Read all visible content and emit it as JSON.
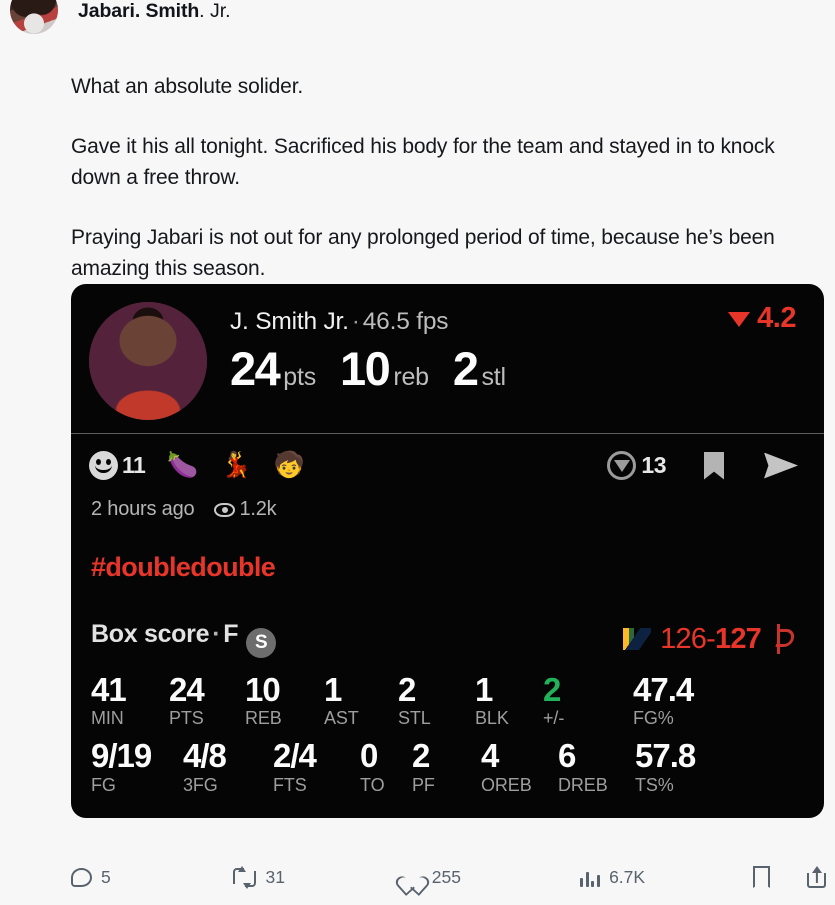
{
  "post": {
    "author": {
      "name_bold": "Jabari. Smith",
      "name_rest": ". Jr."
    },
    "paragraphs": [
      "What an absolute solider.",
      "Gave it his all tonight. Sacrificed his body for the team and stayed in to knock down a free throw.",
      "Praying Jabari is not out for any prolonged period of time, because he’s been amazing this season."
    ]
  },
  "card": {
    "player_name": "J. Smith Jr.",
    "separator": "·",
    "fps": "46.5 fps",
    "delta": {
      "icon": "triangle-down-icon",
      "value": "4.2",
      "color": "#e8352a"
    },
    "big_stats": [
      {
        "value": "24",
        "label": "pts"
      },
      {
        "value": "10",
        "label": "reb"
      },
      {
        "value": "2",
        "label": "stl"
      }
    ],
    "reactions": {
      "smiley_count": "11",
      "emojis": [
        "🍆",
        "💃",
        "🧒"
      ],
      "vote_count": "13",
      "bookmark_icon": "bookmark-icon",
      "send_icon": "send-icon"
    },
    "meta": {
      "time": "2 hours ago",
      "views": "1.2k"
    },
    "hashtag": "#doubledouble",
    "boxscore": {
      "title": "Box score",
      "dot": "·",
      "position": "F",
      "badge": "S",
      "score": {
        "away": "126",
        "dash": "-",
        "home": "127",
        "color": "#e8352a"
      },
      "row1": [
        {
          "value": "41",
          "label": "MIN",
          "positive": false
        },
        {
          "value": "24",
          "label": "PTS",
          "positive": false
        },
        {
          "value": "10",
          "label": "REB",
          "positive": false
        },
        {
          "value": "1",
          "label": "AST",
          "positive": false
        },
        {
          "value": "2",
          "label": "STL",
          "positive": false
        },
        {
          "value": "1",
          "label": "BLK",
          "positive": false
        },
        {
          "value": "2",
          "label": "+/-",
          "positive": true
        },
        {
          "value": "47.4",
          "label": "FG%",
          "positive": false
        }
      ],
      "row2": [
        {
          "value": "9/19",
          "label": "FG",
          "positive": false
        },
        {
          "value": "4/8",
          "label": "3FG",
          "positive": false
        },
        {
          "value": "2/4",
          "label": "FTS",
          "positive": false
        },
        {
          "value": "0",
          "label": "TO",
          "positive": false
        },
        {
          "value": "2",
          "label": "PF",
          "positive": false
        },
        {
          "value": "4",
          "label": "OREB",
          "positive": false
        },
        {
          "value": "6",
          "label": "DREB",
          "positive": false
        },
        {
          "value": "57.8",
          "label": "TS%",
          "positive": false
        }
      ]
    }
  },
  "actions": {
    "reply_count": "5",
    "retweet_count": "31",
    "like_count": "255",
    "view_count": "6.7K",
    "bookmark_icon": "bookmark-icon",
    "share_icon": "share-icon"
  }
}
